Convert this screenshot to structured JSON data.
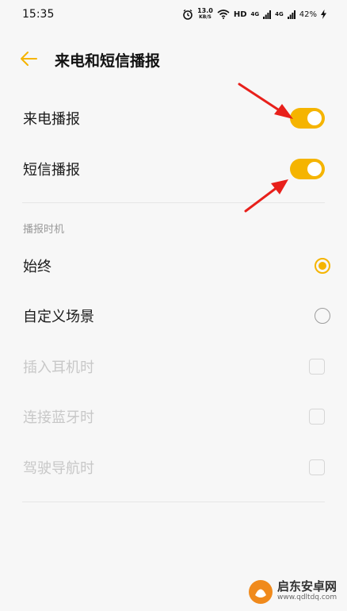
{
  "status_bar": {
    "time": "15:35",
    "speed_value": "13.0",
    "speed_unit": "KB/S",
    "hd_label": "HD",
    "net1": "4G",
    "net2": "4G",
    "battery": "42%"
  },
  "header": {
    "title": "来电和短信播报",
    "back_icon": "back-arrow-icon"
  },
  "toggles": [
    {
      "label": "来电播报",
      "on": true
    },
    {
      "label": "短信播报",
      "on": true
    }
  ],
  "section": {
    "title": "播报时机"
  },
  "radio_options": [
    {
      "label": "始终",
      "selected": true
    },
    {
      "label": "自定义场景",
      "selected": false
    }
  ],
  "checkbox_options": [
    {
      "label": "插入耳机时",
      "checked": false,
      "enabled": false
    },
    {
      "label": "连接蓝牙时",
      "checked": false,
      "enabled": false
    },
    {
      "label": "驾驶导航时",
      "checked": false,
      "enabled": false
    }
  ],
  "colors": {
    "accent": "#f5b400",
    "annotation_arrow": "#e8201b"
  },
  "watermark": {
    "name": "启东安卓网",
    "url": "www.qdltdq.com"
  }
}
